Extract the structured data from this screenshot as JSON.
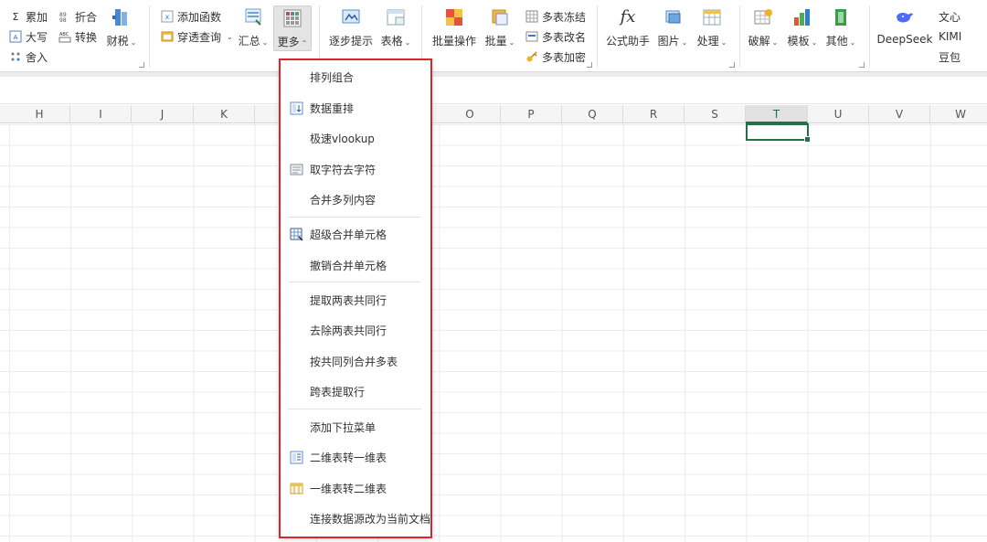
{
  "ribbon": {
    "group1": {
      "sum": "累加",
      "upper": "大写",
      "round": "舍入",
      "fold": "折合",
      "convert": "转换",
      "tax": "财税"
    },
    "group2": {
      "add_func": "添加函数",
      "pivot_query": "穿透查询",
      "summary": "汇总",
      "more": "更多"
    },
    "group3": {
      "step_hint": "逐步提示",
      "table": "表格"
    },
    "group4": {
      "batch_op": "批量操作",
      "batch": "批量",
      "freeze": "多表冻结",
      "rename": "多表改名",
      "encrypt": "多表加密"
    },
    "group5": {
      "formula": "公式助手",
      "image": "图片",
      "process": "处理"
    },
    "group6": {
      "crack": "破解",
      "template": "模板",
      "other": "其他"
    },
    "group7": {
      "deepseek": "DeepSeek",
      "wenxin": "文心",
      "kimi": "KIMI",
      "doubao": "豆包"
    }
  },
  "columns": [
    {
      "label": "H"
    },
    {
      "label": "I"
    },
    {
      "label": "J"
    },
    {
      "label": "K"
    },
    {
      "label": "O"
    },
    {
      "label": "P"
    },
    {
      "label": "Q"
    },
    {
      "label": "R"
    },
    {
      "label": "S"
    },
    {
      "label": "T",
      "selected": true
    },
    {
      "label": "U"
    },
    {
      "label": "V"
    },
    {
      "label": "W"
    }
  ],
  "menu": {
    "items": [
      {
        "label": "排列组合",
        "icon": "none"
      },
      {
        "label": "数据重排",
        "icon": "reorder-icon"
      },
      {
        "label": "极速vlookup",
        "icon": "none"
      },
      {
        "label": "取字符去字符",
        "icon": "text-extract-icon"
      },
      {
        "label": "合并多列内容",
        "icon": "none"
      },
      {
        "label": "超级合并单元格",
        "icon": "merge-cells-icon"
      },
      {
        "label": "撤销合并单元格",
        "icon": "none"
      },
      {
        "label": "提取两表共同行",
        "icon": "none"
      },
      {
        "label": "去除两表共同行",
        "icon": "none"
      },
      {
        "label": "按共同列合并多表",
        "icon": "none"
      },
      {
        "label": "跨表提取行",
        "icon": "none"
      },
      {
        "label": "添加下拉菜单",
        "icon": "none"
      },
      {
        "label": "二维表转一维表",
        "icon": "2d-to-1d-icon"
      },
      {
        "label": "一维表转二维表",
        "icon": "1d-to-2d-icon"
      },
      {
        "label": "连接数据源改为当前文档",
        "icon": "none"
      }
    ]
  },
  "colors": {
    "accent_green": "#217346",
    "menu_border": "#d9262c"
  }
}
